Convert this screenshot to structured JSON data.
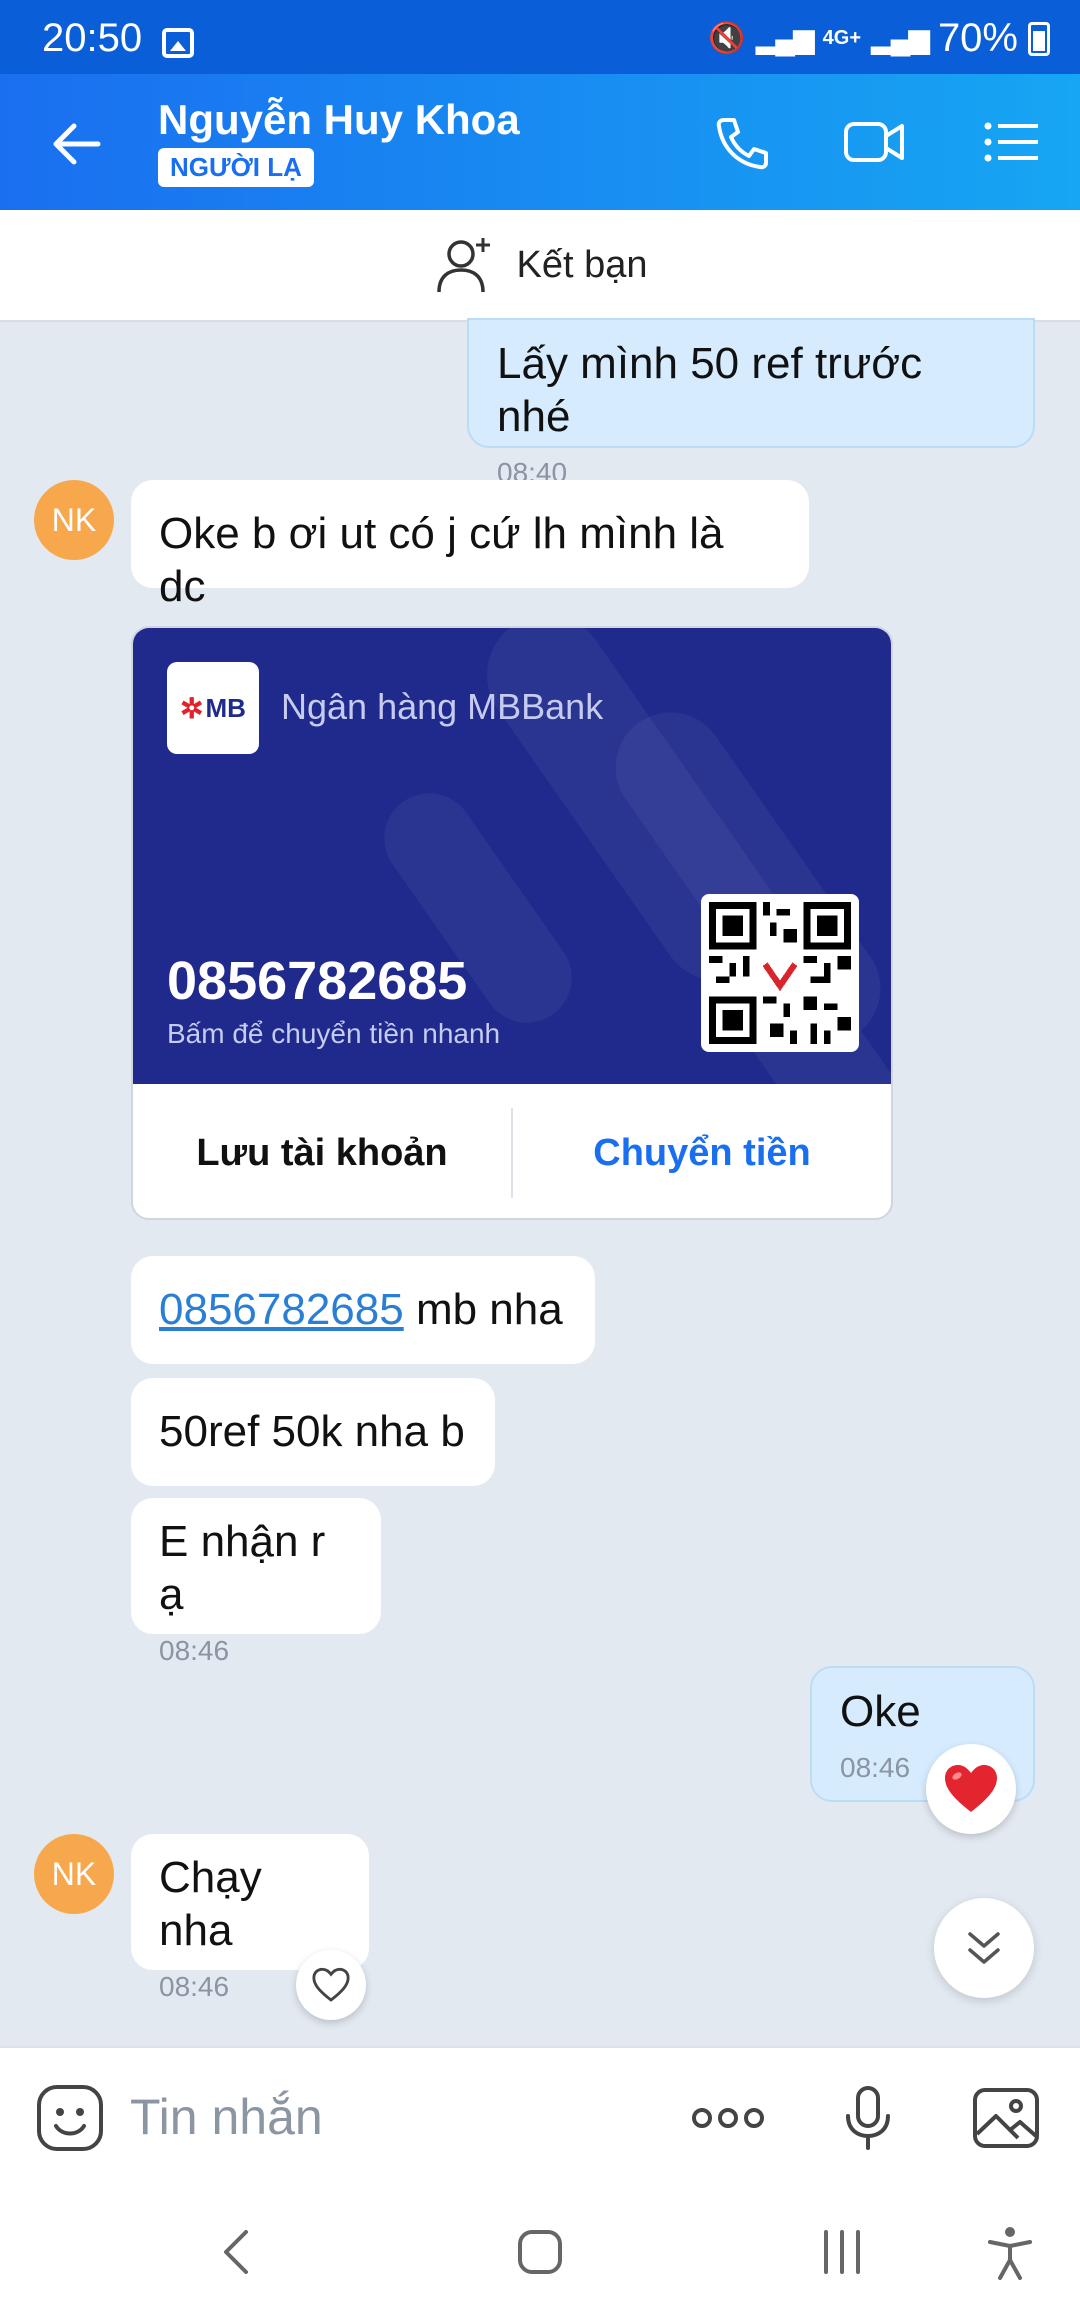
{
  "status_bar": {
    "time": "20:50",
    "network": "4G+",
    "battery": "70%"
  },
  "header": {
    "contact_name": "Nguyễn Huy Khoa",
    "badge": "NGƯỜI LẠ"
  },
  "add_friend": {
    "label": "Kết bạn"
  },
  "avatar_initials": "NK",
  "messages": [
    {
      "direction": "out",
      "text": "Lấy mình 50 ref trước nhé",
      "time": "08:40"
    },
    {
      "direction": "in",
      "text": "Oke b ơi ut có j cứ lh mình là dc"
    },
    {
      "direction": "in",
      "link": "0856782685",
      "text": " mb nha"
    },
    {
      "direction": "in",
      "text": "50ref 50k nha b"
    },
    {
      "direction": "in",
      "text": "E nhận r ạ",
      "time": "08:46"
    },
    {
      "direction": "out",
      "text": "Oke",
      "time": "08:46"
    },
    {
      "direction": "in",
      "text": "Chạy nha",
      "time": "08:46"
    }
  ],
  "bank_card": {
    "logo_text": "MB",
    "bank_name": "Ngân hàng MBBank",
    "account_number": "0856782685",
    "subtitle": "Bấm để chuyển tiền nhanh",
    "save_label": "Lưu tài khoản",
    "transfer_label": "Chuyển tiền"
  },
  "input": {
    "placeholder": "Tin nhắn"
  },
  "colors": {
    "header": "#1a6ff0",
    "bank_card": "#1f2a8c",
    "link": "#2a7fd4",
    "avatar": "#f7a84c"
  }
}
